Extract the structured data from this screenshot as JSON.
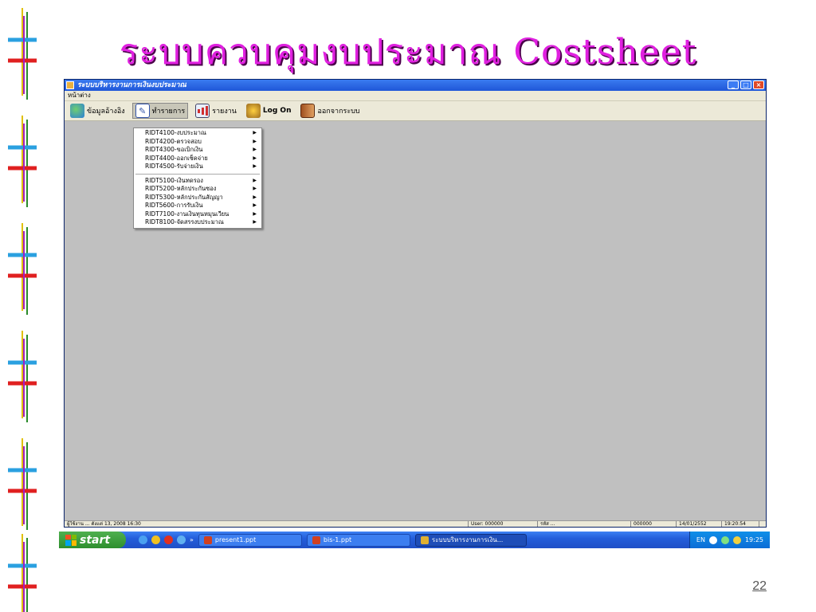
{
  "slide": {
    "title": "ระบบควบคุมงบประมาณ Costsheet",
    "page_number": "22"
  },
  "window": {
    "title": "ระบบบริหารงานการเงินงบประมาณ",
    "menu": "หน้าต่าง",
    "toolbar": [
      {
        "label": "ข้อมูลอ้างอิง",
        "icon": "reference-data-icon"
      },
      {
        "label": "ทำรายการ",
        "icon": "transaction-icon"
      },
      {
        "label": "รายงาน",
        "icon": "report-icon"
      },
      {
        "label": "Log On",
        "icon": "logon-icon"
      },
      {
        "label": "ออกจากระบบ",
        "icon": "exit-door-icon"
      }
    ],
    "dropdown_group1": [
      "RIDT4100-งบประมาณ",
      "RIDT4200-ตรวจสอบ",
      "RIDT4300-ขอเบิกเงิน",
      "RIDT4400-ออกเช็คจ่าย",
      "RIDT4500-รับจ่ายเงิน"
    ],
    "dropdown_group2": [
      "RIDT5100-เงินทดรอง",
      "RIDT5200-หลักประกันซอง",
      "RIDT5300-หลักประกันสัญญา",
      "RIDT5600-การรับเงิน",
      "RIDT7100-งานเงินทุนหมุนเวียน",
      "RIDT8100-จัดสรรงบประมาณ"
    ],
    "status": [
      "ผู้ใช้งาน ... ตั้งแต่ 13, 2008 16:30",
      "User: 000000",
      "รหัส ...",
      "000000",
      "14/01/2552",
      "19:20:54"
    ]
  },
  "taskbar": {
    "start_label": "start",
    "tasks": [
      "present1.ppt",
      "bis-1.ppt",
      "ระบบบริหารงานการเงิน..."
    ],
    "language": "EN",
    "clock": "19:25"
  }
}
